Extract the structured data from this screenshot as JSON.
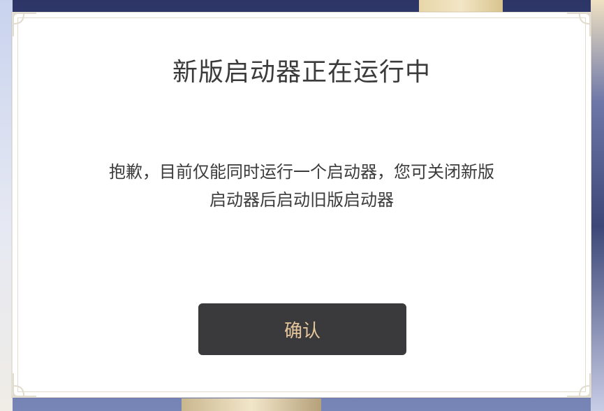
{
  "dialog": {
    "title": "新版启动器正在运行中",
    "message_line1": "抱歉，目前仅能同时运行一个启动器，您可关闭新版",
    "message_line2": "启动器后启动旧版启动器",
    "confirm_label": "确认"
  },
  "colors": {
    "dialog_background": "#ffffff",
    "frame_border": "#e2dccf",
    "text": "#3b3b3b",
    "button_background": "#3a3a3c",
    "button_text": "#e6c79c"
  },
  "icons": {
    "corner_ornament": "corner-ornament-icon"
  }
}
